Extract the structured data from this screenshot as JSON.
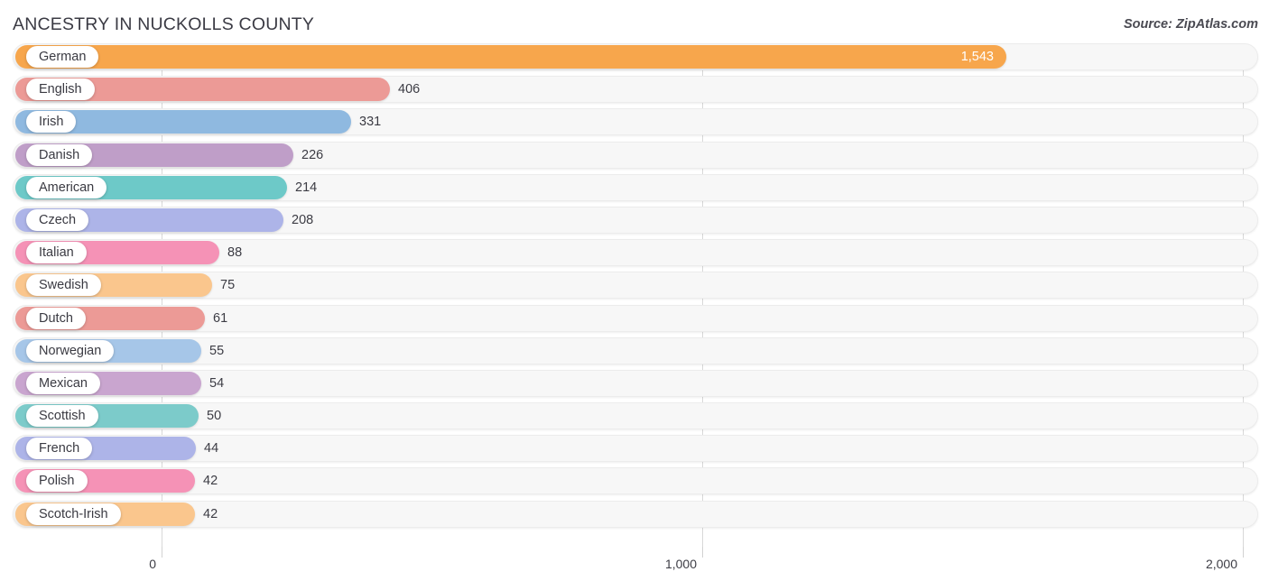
{
  "header": {
    "title": "ANCESTRY IN NUCKOLLS COUNTY",
    "source": "Source: ZipAtlas.com"
  },
  "chart_data": {
    "type": "bar",
    "orientation": "horizontal",
    "title": "ANCESTRY IN NUCKOLLS COUNTY",
    "xlabel": "",
    "ylabel": "",
    "xlim": [
      0,
      2000
    ],
    "grid": true,
    "legend": "none",
    "tick_labels": [
      "0",
      "1,000",
      "2,000"
    ],
    "ticks": [
      0,
      1000,
      2000
    ],
    "categories": [
      "German",
      "English",
      "Irish",
      "Danish",
      "American",
      "Czech",
      "Italian",
      "Swedish",
      "Dutch",
      "Norwegian",
      "Mexican",
      "Scottish",
      "French",
      "Polish",
      "Scotch-Irish"
    ],
    "values": [
      1543,
      406,
      331,
      226,
      214,
      208,
      88,
      75,
      61,
      55,
      54,
      50,
      44,
      42,
      42
    ],
    "value_labels": [
      "1,543",
      "406",
      "331",
      "226",
      "214",
      "208",
      "88",
      "75",
      "61",
      "55",
      "54",
      "50",
      "44",
      "42",
      "42"
    ],
    "colors": [
      "#f7a64c",
      "#ec9a96",
      "#8fb9e0",
      "#bf9ec8",
      "#6dc9c8",
      "#adb4e8",
      "#f592b6",
      "#fac68d",
      "#ec9a96",
      "#a6c6e8",
      "#c9a5cf",
      "#7ccbca",
      "#adb4e8",
      "#f592b6",
      "#fac68d"
    ]
  },
  "rows": [
    {
      "label": "German",
      "value_label": "1,543",
      "color": "#f7a64c",
      "bar_end": 1115,
      "label_inside": true
    },
    {
      "label": "English",
      "value_label": "406",
      "color": "#ec9a96",
      "bar_end": 432,
      "label_inside": false
    },
    {
      "label": "Irish",
      "value_label": "331",
      "color": "#8fb9e0",
      "bar_end": 389,
      "label_inside": false
    },
    {
      "label": "Danish",
      "value_label": "226",
      "color": "#bf9ec8",
      "bar_end": 325,
      "label_inside": false
    },
    {
      "label": "American",
      "value_label": "214",
      "color": "#6dc9c8",
      "bar_end": 318,
      "label_inside": false
    },
    {
      "label": "Czech",
      "value_label": "208",
      "color": "#adb4e8",
      "bar_end": 314,
      "label_inside": false
    },
    {
      "label": "Italian",
      "value_label": "88",
      "color": "#f592b6",
      "bar_end": 243,
      "label_inside": false
    },
    {
      "label": "Swedish",
      "value_label": "75",
      "color": "#fac68d",
      "bar_end": 235,
      "label_inside": false
    },
    {
      "label": "Dutch",
      "value_label": "61",
      "color": "#ec9a96",
      "bar_end": 227,
      "label_inside": false
    },
    {
      "label": "Norwegian",
      "value_label": "55",
      "color": "#a6c6e8",
      "bar_end": 223,
      "label_inside": false
    },
    {
      "label": "Mexican",
      "value_label": "54",
      "color": "#c9a5cf",
      "bar_end": 223,
      "label_inside": false
    },
    {
      "label": "Scottish",
      "value_label": "50",
      "color": "#7ccbca",
      "bar_end": 220,
      "label_inside": false
    },
    {
      "label": "French",
      "value_label": "44",
      "color": "#adb4e8",
      "bar_end": 217,
      "label_inside": false
    },
    {
      "label": "Polish",
      "value_label": "42",
      "color": "#f592b6",
      "bar_end": 216,
      "label_inside": false
    },
    {
      "label": "Scotch-Irish",
      "value_label": "42",
      "color": "#fac68d",
      "bar_end": 216,
      "label_inside": false
    }
  ],
  "axis": {
    "ticks": [
      {
        "label": "0",
        "x": 179
      },
      {
        "label": "1,000",
        "x": 778
      },
      {
        "label": "2,000",
        "x": 1377
      }
    ]
  }
}
